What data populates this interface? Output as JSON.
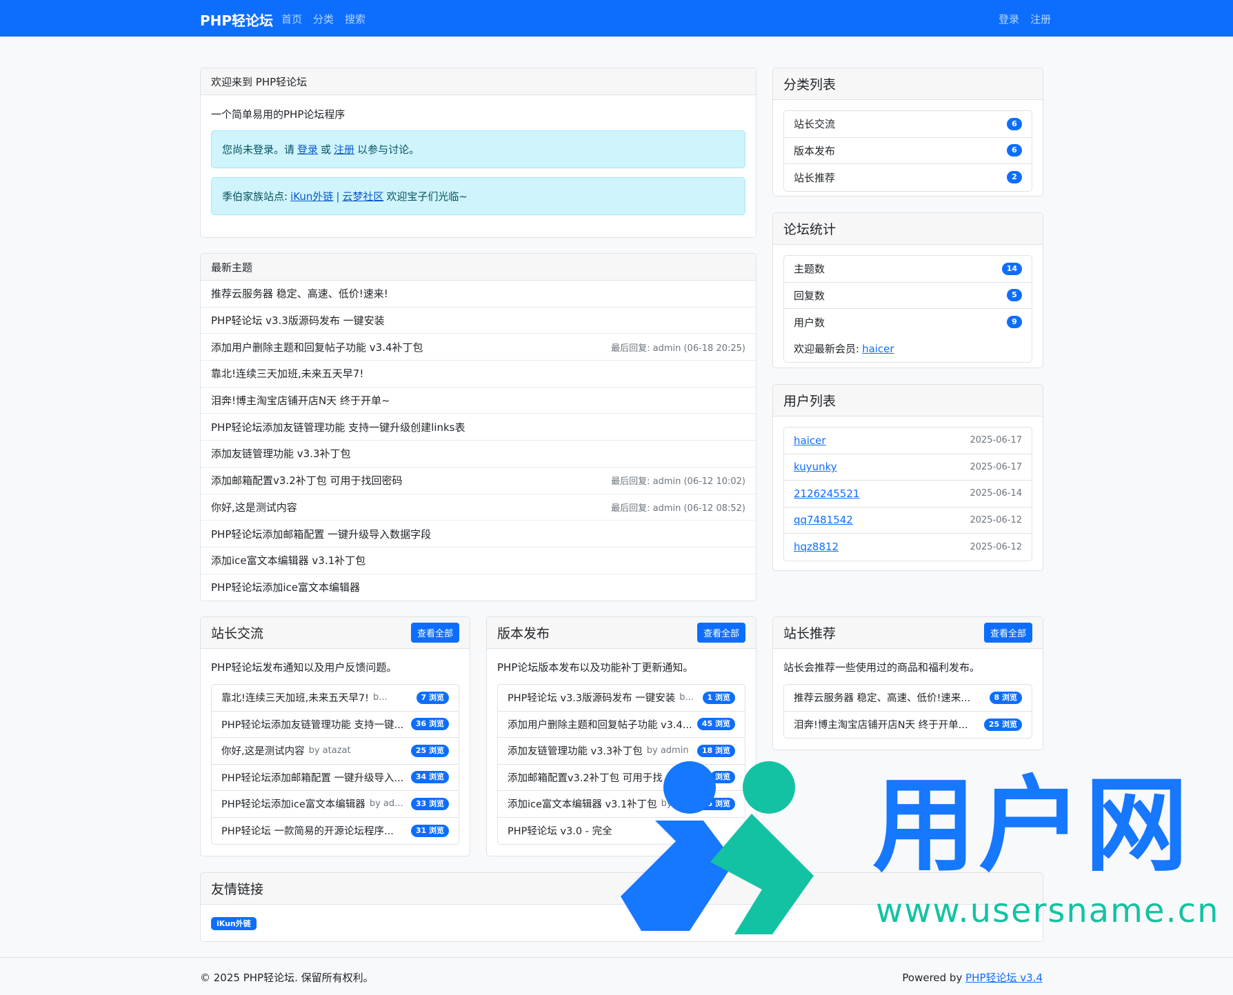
{
  "nav": {
    "brand": "PHP轻论坛",
    "links": [
      "首页",
      "分类",
      "搜索"
    ],
    "login": "登录",
    "register": "注册"
  },
  "welcome": {
    "title": "欢迎来到 PHP轻论坛",
    "intro": "一个简单易用的PHP论坛程序",
    "alert1": {
      "prefix": "您尚未登录。请",
      "login": "登录",
      "or": "或",
      "register": "注册",
      "suffix": "以参与讨论。"
    },
    "alert2": {
      "prefix": "季伯家族站点:",
      "link1": "iKun外链",
      "sep": "|",
      "link2": "云梦社区",
      "suffix": "欢迎宝子们光临~"
    }
  },
  "latest": {
    "title": "最新主题",
    "topics": [
      {
        "title": "推荐云服务器 稳定、高速、低价!速来!",
        "meta": ""
      },
      {
        "title": "PHP轻论坛 v3.3版源码发布 一键安装",
        "meta": ""
      },
      {
        "title": "添加用户删除主题和回复帖子功能 v3.4补丁包",
        "meta": "最后回复: admin (06-18 20:25)"
      },
      {
        "title": "靠北!连续三天加班,未来五天早7!",
        "meta": ""
      },
      {
        "title": "泪奔!博主淘宝店铺开店N天 终于开单~",
        "meta": ""
      },
      {
        "title": "PHP轻论坛添加友链管理功能 支持一键升级创建links表",
        "meta": ""
      },
      {
        "title": "添加友链管理功能 v3.3补丁包",
        "meta": ""
      },
      {
        "title": "添加邮箱配置v3.2补丁包 可用于找回密码",
        "meta": "最后回复: admin (06-12 10:02)"
      },
      {
        "title": "你好,这是测试内容",
        "meta": "最后回复: admin (06-12 08:52)"
      },
      {
        "title": "PHP轻论坛添加邮箱配置 一键升级导入数据字段",
        "meta": ""
      },
      {
        "title": "添加ice富文本编辑器 v3.1补丁包",
        "meta": ""
      },
      {
        "title": "PHP轻论坛添加ice富文本编辑器",
        "meta": ""
      }
    ]
  },
  "categories": {
    "title": "分类列表",
    "items": [
      {
        "name": "站长交流",
        "count": "6"
      },
      {
        "name": "版本发布",
        "count": "6"
      },
      {
        "name": "站长推荐",
        "count": "2"
      }
    ]
  },
  "stats": {
    "title": "论坛统计",
    "items": [
      {
        "name": "主题数",
        "count": "14"
      },
      {
        "name": "回复数",
        "count": "5"
      },
      {
        "name": "用户数",
        "count": "9"
      }
    ],
    "newest_label": "欢迎最新会员:",
    "newest_user": "haicer"
  },
  "users": {
    "title": "用户列表",
    "items": [
      {
        "name": "haicer",
        "date": "2025-06-17"
      },
      {
        "name": "kuyunky",
        "date": "2025-06-17"
      },
      {
        "name": "2126245521",
        "date": "2025-06-14"
      },
      {
        "name": "qq7481542",
        "date": "2025-06-12"
      },
      {
        "name": "hqz8812",
        "date": "2025-06-12"
      }
    ]
  },
  "sections": [
    {
      "title": "站长交流",
      "button": "查看全部",
      "desc": "PHP轻论坛发布通知以及用户反馈问题。",
      "items": [
        {
          "title": "靠北!连续三天加班,未来五天早7!",
          "by": "b...",
          "views": "7 浏览"
        },
        {
          "title": "PHP轻论坛添加友链管理功能 支持一键...",
          "by": "",
          "views": "36 浏览"
        },
        {
          "title": "你好,这是测试内容",
          "by": "by atazat",
          "views": "25 浏览"
        },
        {
          "title": "PHP轻论坛添加邮箱配置 一键升级导入...",
          "by": "",
          "views": "34 浏览"
        },
        {
          "title": "PHP轻论坛添加ice富文本编辑器",
          "by": "by ad...",
          "views": "33 浏览"
        },
        {
          "title": "PHP轻论坛 一款简易的开源论坛程序...",
          "by": "",
          "views": "31 浏览"
        }
      ]
    },
    {
      "title": "版本发布",
      "button": "查看全部",
      "desc": "PHP论坛版本发布以及功能补丁更新通知。",
      "items": [
        {
          "title": "PHP轻论坛 v3.3版源码发布 一键安装",
          "by": "b...",
          "views": "1 浏览"
        },
        {
          "title": "添加用户删除主题和回复帖子功能 v3.4...",
          "by": "",
          "views": "45 浏览"
        },
        {
          "title": "添加友链管理功能 v3.3补丁包",
          "by": "by admin",
          "views": "18 浏览"
        },
        {
          "title": "添加邮箱配置v3.2补丁包 可用于找",
          "by": "",
          "views": "浏览"
        },
        {
          "title": "添加ice富文本编辑器 v3.1补丁包",
          "by": "by",
          "views": "35 浏览"
        },
        {
          "title": "PHP轻论坛 v3.0 - 完全",
          "by": "",
          "views": ""
        }
      ]
    },
    {
      "title": "站长推荐",
      "button": "查看全部",
      "desc": "站长会推荐一些使用过的商品和福利发布。",
      "items": [
        {
          "title": "推荐云服务器 稳定、高速、低价!速来...",
          "by": "",
          "views": "8 浏览"
        },
        {
          "title": "泪奔!博主淘宝店铺开店N天 终于开单...",
          "by": "",
          "views": "25 浏览"
        }
      ]
    }
  ],
  "friends": {
    "title": "友情链接",
    "links": [
      "iKun外链"
    ]
  },
  "footer": {
    "copyright": "© 2025 PHP轻论坛. 保留所有权利。",
    "powered_prefix": "Powered by",
    "powered_link": "PHP轻论坛 v3.4"
  },
  "watermark": {
    "brand": "用户网",
    "url": "www.usersname.cn",
    "colors": {
      "blue": "#1677ff",
      "teal": "#13c2a3"
    }
  }
}
